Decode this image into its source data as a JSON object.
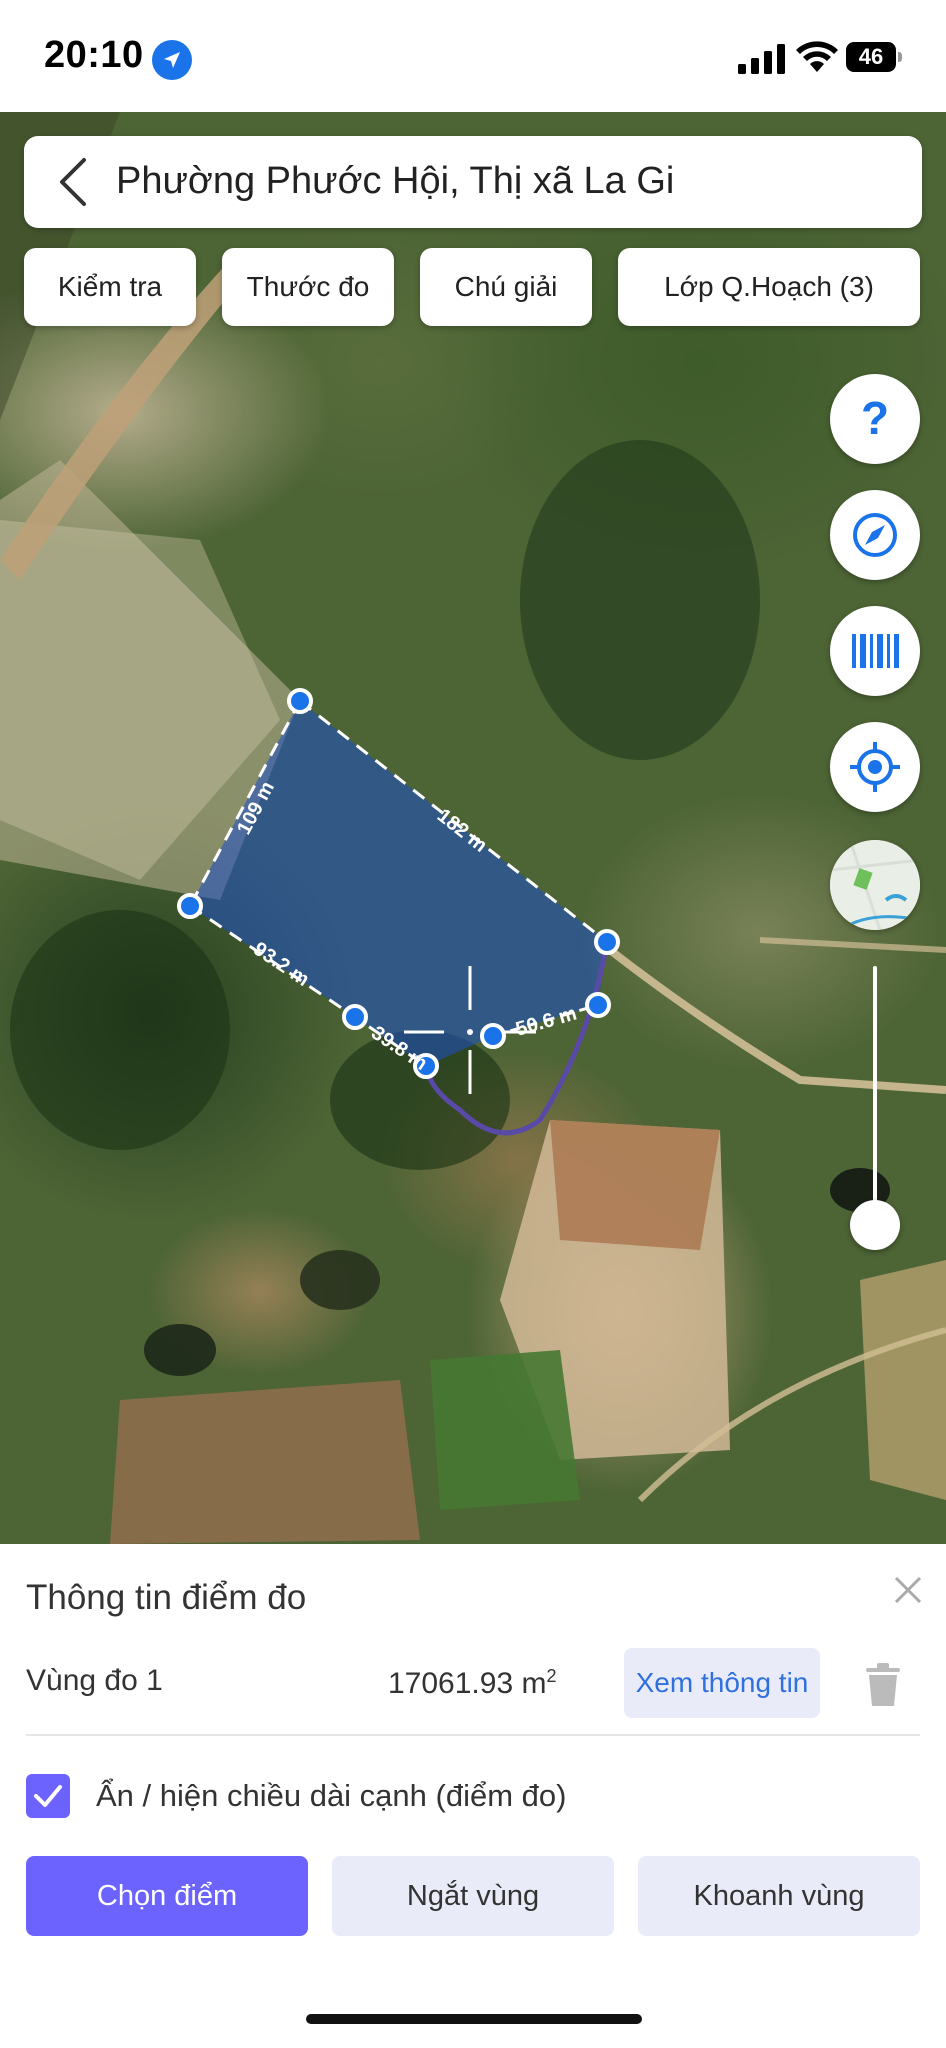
{
  "status_bar": {
    "time": "20:10",
    "battery": "46"
  },
  "search": {
    "title": "Phường Phước Hội, Thị xã La Gi"
  },
  "toolbar": {
    "buttons": [
      {
        "label": "Kiểm tra"
      },
      {
        "label": "Thước đo"
      },
      {
        "label": "Chú giải"
      },
      {
        "label": "Lớp Q.Hoạch (3)"
      }
    ]
  },
  "map": {
    "edge_labels": [
      "109 m",
      "182 m",
      "93.2 m",
      "39.8 m",
      "50.6 m"
    ],
    "controls": [
      "help-icon",
      "compass-icon",
      "barcode-icon",
      "locate-icon",
      "map-layer-thumbnail"
    ],
    "accent_color": "#1a73e8",
    "polygon_fill": "rgba(30,80,200,0.55)"
  },
  "panel": {
    "title": "Thông tin điểm đo",
    "area": {
      "label": "Vùng đo 1",
      "value": "17061.93 m",
      "unit_sup": "2"
    },
    "view_button": "Xem thông tin",
    "checkbox_label": "Ẩn / hiện chiều dài cạnh (điểm đo)",
    "checkbox_checked": true,
    "actions": [
      {
        "label": "Chọn điểm"
      },
      {
        "label": "Ngắt vùng"
      },
      {
        "label": "Khoanh vùng"
      }
    ],
    "primary_color": "#6c63ff"
  }
}
